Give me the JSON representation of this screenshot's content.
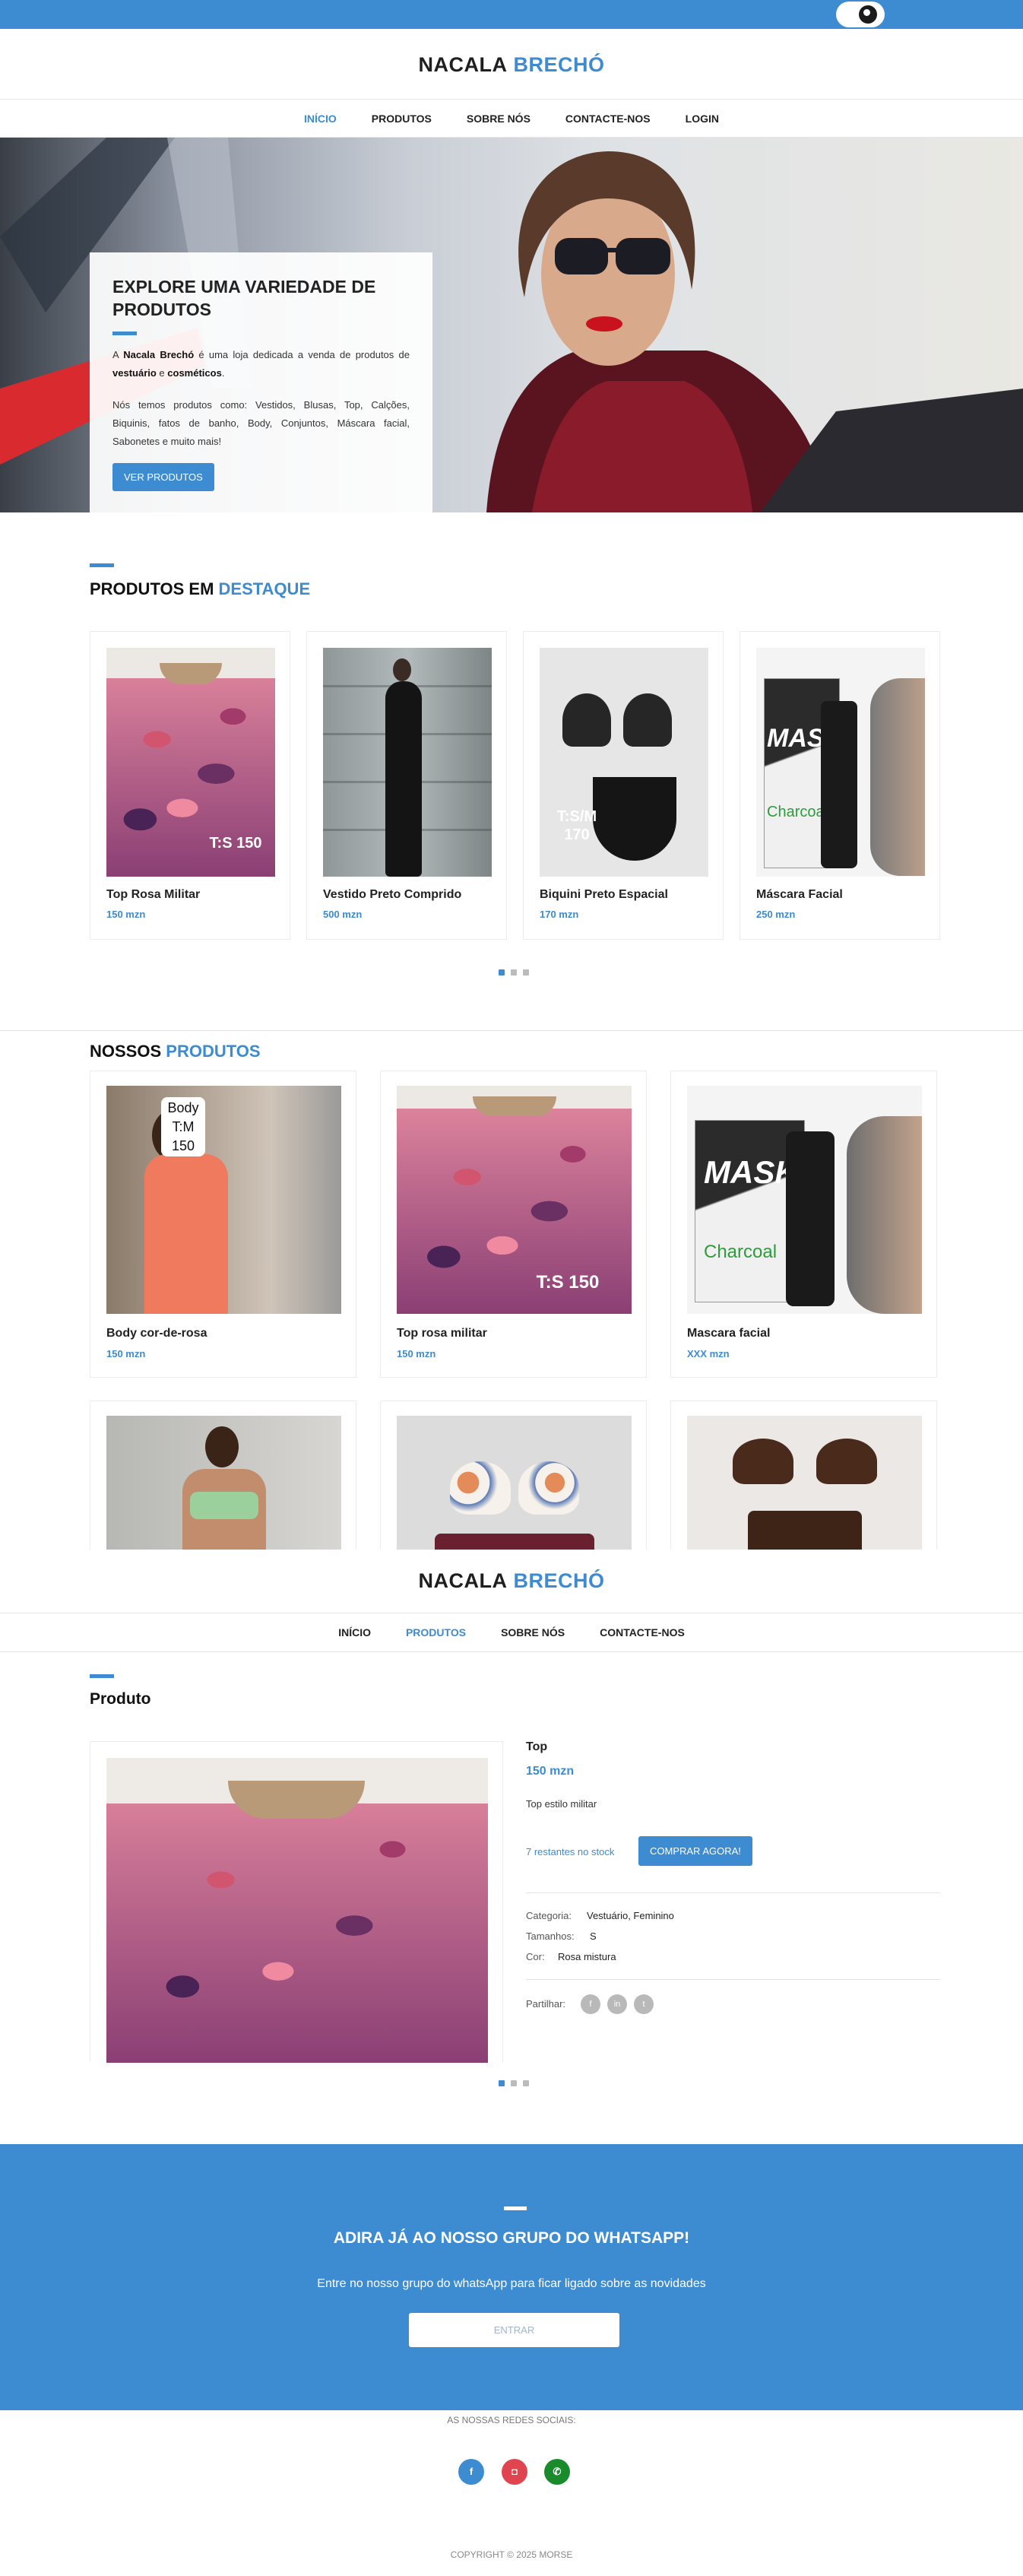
{
  "brand": {
    "part1": "NACALA",
    "part2": "BRECHÓ"
  },
  "nav": {
    "items": [
      "INÍCIO",
      "PRODUTOS",
      "SOBRE NÓS",
      "CONTACTE-NOS",
      "LOGIN"
    ]
  },
  "nav2": {
    "items": [
      "INÍCIO",
      "PRODUTOS",
      "SOBRE NÓS",
      "CONTACTE-NOS"
    ]
  },
  "hero": {
    "title": "EXPLORE UMA VARIEDADE DE PRODUTOS",
    "p1_a": "A ",
    "p1_brand": "Nacala Brechó",
    "p1_b": " é uma loja dedicada a venda de produtos de ",
    "p1_cat1": "vestuário",
    "p1_c": " e ",
    "p1_cat2": "cosméticos",
    "p1_d": ".",
    "p2": "Nós temos produtos como: Vestidos, Blusas, Top, Calções, Biquinis, fatos de banho, Body, Conjuntos, Máscara facial, Sabonetes e muito mais!",
    "button": "VER PRODUTOS"
  },
  "featured": {
    "title_a": "PRODUTOS EM",
    "title_b": "DESTAQUE",
    "items": [
      {
        "name": "Top Rosa Militar",
        "price": "150 mzn",
        "tag": "T:S 150"
      },
      {
        "name": "Vestido Preto Comprido",
        "price": "500 mzn",
        "tag": ""
      },
      {
        "name": "Biquini Preto Espacial",
        "price": "170 mzn",
        "tag": "T:S/M 170"
      },
      {
        "name": "Máscara Facial",
        "price": "250 mzn",
        "tag": ""
      }
    ]
  },
  "products": {
    "title_a": "NOSSOS",
    "title_b": "PRODUTOS",
    "items": [
      {
        "name": "Body cor-de-rosa",
        "price": "150 mzn",
        "tag": "Body T:M 150"
      },
      {
        "name": "Top rosa militar",
        "price": "150 mzn",
        "tag": "T:S 150"
      },
      {
        "name": "Mascara facial",
        "price": "XXX mzn",
        "tag": ""
      }
    ]
  },
  "product_detail": {
    "section_title": "Produto",
    "name": "Top",
    "price": "150 mzn",
    "description": "Top estilo militar",
    "stock": "7 restantes no stock",
    "buy_button": "COMPRAR AGORA!",
    "category_label": "Categoria:",
    "category_value": "Vestuário, Feminino",
    "sizes_label": "Tamanhos:",
    "sizes_value": "S",
    "color_label": "Cor:",
    "color_value": "Rosa mistura",
    "share_label": "Partilhar:"
  },
  "mask_text": {
    "brand": "MASK",
    "sub": "Charcoal"
  },
  "whatsapp": {
    "title": "ADIRA JÁ AO NOSSO GRUPO DO WHATSAPP!",
    "text": "Entre no nosso grupo do whatsApp para ficar ligado sobre as novidades",
    "button": "ENTRAR"
  },
  "footer": {
    "social_label": "AS NOSSAS REDES SOCIAIS:",
    "copyright": "COPYRIGHT © 2025 MORSE"
  },
  "colors": {
    "accent": "#3d8bd0",
    "facebook": "#3d8bd0",
    "instagram": "#e0444e",
    "whatsapp": "#1a8b2c"
  }
}
